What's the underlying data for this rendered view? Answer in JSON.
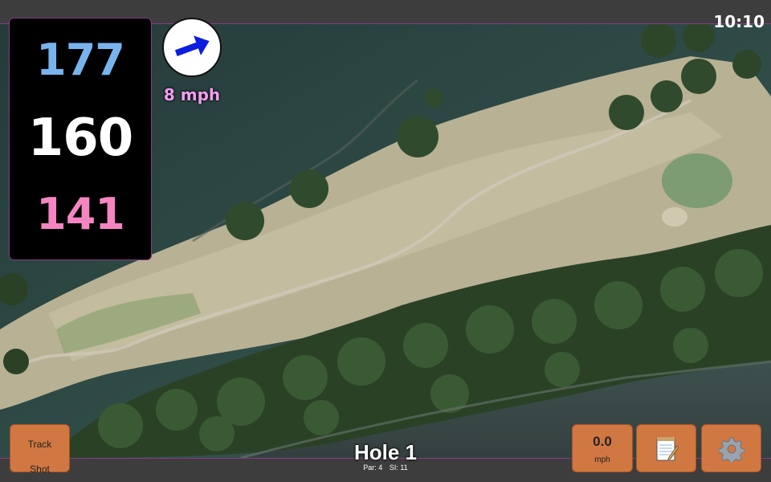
{
  "status": {
    "time": "10:10"
  },
  "distances": {
    "back": "177",
    "middle": "160",
    "front": "141"
  },
  "wind": {
    "speed_label": "8 mph",
    "direction_icon": "wind-arrow-icon",
    "arrow_color": "#0a1de0"
  },
  "hole": {
    "title": "Hole 1",
    "par": "Par: 4",
    "stroke_index": "SI: 11"
  },
  "buttons": {
    "track_shot": [
      "Track",
      "Shot"
    ],
    "speed_value": "0.0",
    "speed_unit": "mph",
    "notes_icon": "notepad-icon",
    "settings_icon": "gear-icon"
  },
  "colors": {
    "accent": "#d07742",
    "back_distance": "#79b3ee",
    "middle_distance": "#ffffff",
    "front_distance": "#f585c2",
    "wind_text": "#f19df1",
    "frame_border": "#8a3a8a"
  }
}
